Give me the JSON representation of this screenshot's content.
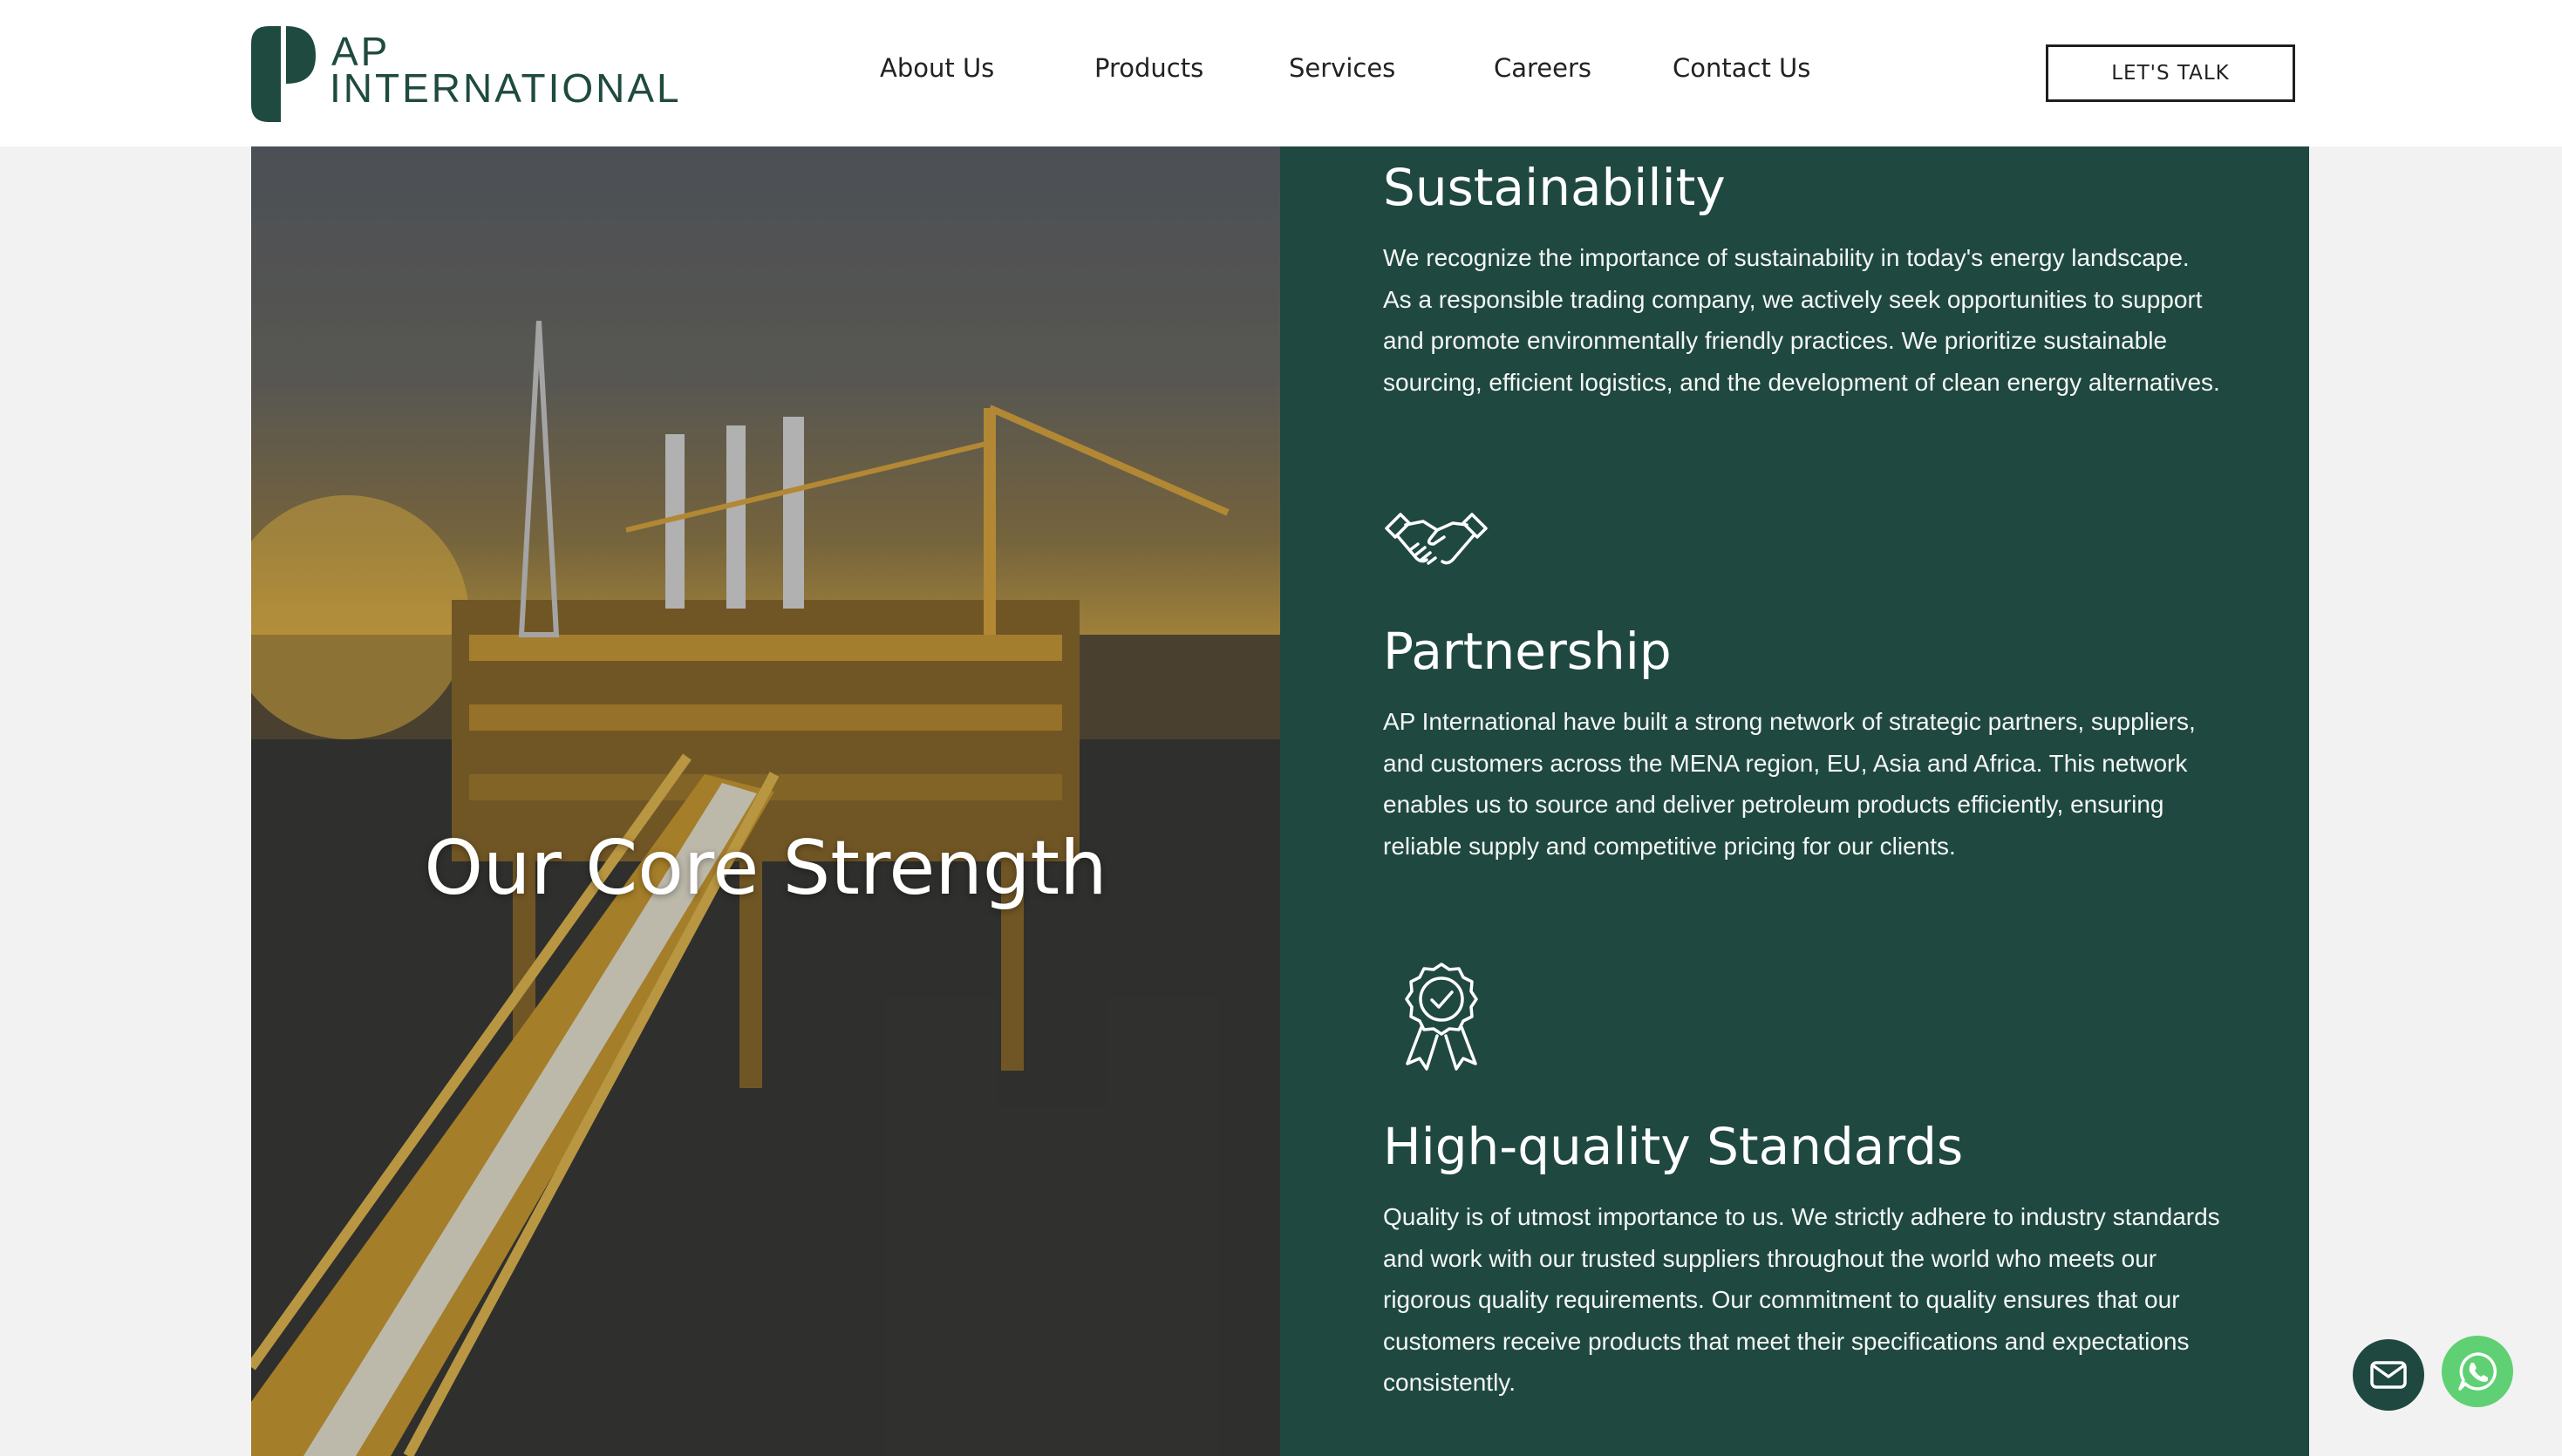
{
  "brand": {
    "line1": "AP",
    "line2": "INTERNATIONAL",
    "color": "#1f4a3f"
  },
  "nav": {
    "items": [
      "About Us",
      "Products",
      "Services",
      "Careers",
      "Contact Us"
    ],
    "cta": "LET'S TALK"
  },
  "hero": {
    "title": "Our Core Strength"
  },
  "features": [
    {
      "icon": "leaf-icon",
      "title": "Sustainability",
      "body": "We recognize the importance of sustainability in today's energy landscape. As a responsible trading company, we actively seek opportunities to support and promote environmentally friendly practices. We prioritize sustainable sourcing, efficient logistics, and the development of clean energy alternatives."
    },
    {
      "icon": "handshake-icon",
      "title": "Partnership",
      "body": "AP International have built a strong network of strategic partners, suppliers, and customers across the MENA region, EU, Asia and Africa. This network enables us to source and deliver petroleum products efficiently, ensuring reliable supply and competitive pricing for our clients."
    },
    {
      "icon": "quality-badge-icon",
      "title": "High-quality Standards",
      "body": "Quality is of utmost importance to us. We strictly adhere to industry standards and work with our trusted suppliers throughout the world who meets our rigorous quality requirements. Our commitment to quality ensures that our customers receive products that meet their specifications and expectations consistently."
    }
  ],
  "colors": {
    "panel": "#1f4840",
    "whatsapp": "#5fd073"
  },
  "floating": {
    "mail_icon": "mail-icon",
    "whatsapp_icon": "whatsapp-icon"
  }
}
